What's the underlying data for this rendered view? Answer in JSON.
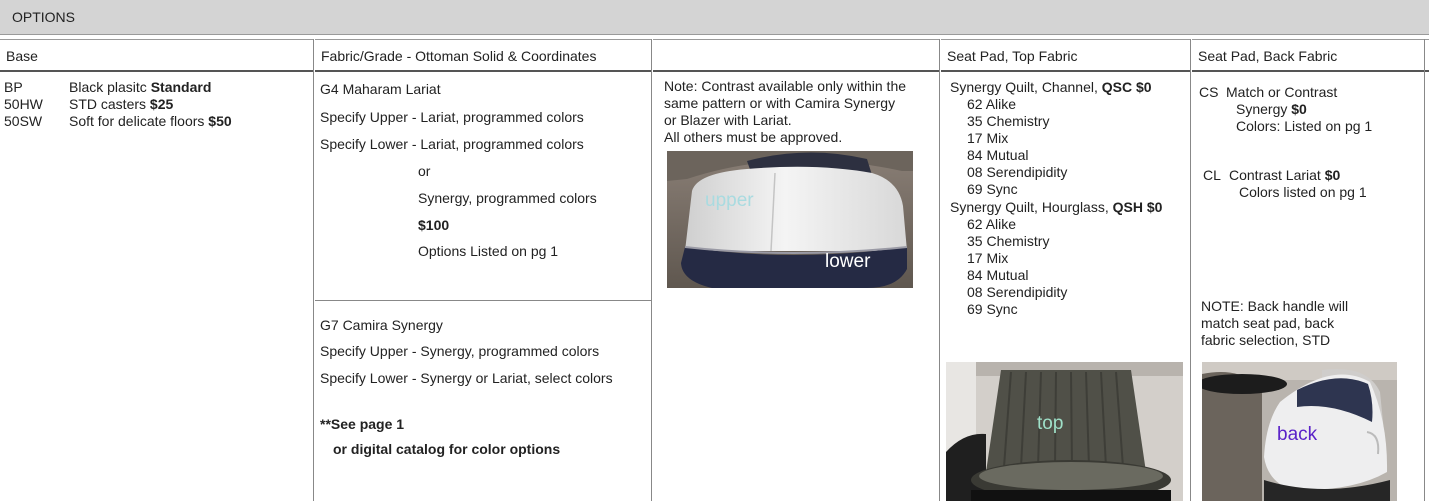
{
  "banner": "OPTIONS",
  "headers": {
    "base": "Base",
    "fabric": "Fabric/Grade - Ottoman Solid & Coordinates",
    "blank": "",
    "seat_top": "Seat Pad, Top Fabric",
    "seat_back": "Seat Pad, Back Fabric"
  },
  "base": {
    "rows": [
      {
        "code": "BP",
        "desc": "Black plasitc ",
        "bold": "Standard"
      },
      {
        "code": "50HW",
        "desc": "STD casters ",
        "bold": "$25"
      },
      {
        "code": "50SW",
        "desc": "Soft for delicate floors ",
        "bold": "$50"
      }
    ]
  },
  "fabric": {
    "g4_title": "G4 Maharam Lariat",
    "g4_upper": "Specify Upper - Lariat, programmed colors",
    "g4_lower": "Specify Lower - Lariat, programmed colors",
    "g4_or": "or",
    "g4_synergy": "Synergy, programmed colors",
    "g4_price": "$100",
    "g4_options": "Options Listed on pg 1",
    "g7_title": "G7 Camira Synergy",
    "g7_upper": "Specify Upper - Synergy, programmed colors",
    "g7_lower": "Specify Lower - Synergy or Lariat, select colors",
    "see1": "**See page 1",
    "see2": "or digital catalog for color options"
  },
  "note": {
    "line1": "Note: Contrast available only within the",
    "line2": "same pattern or with Camira Synergy",
    "line3": "or Blazer with Lariat.",
    "line4": "All others must be approved.",
    "img_upper": "upper",
    "img_lower": "lower"
  },
  "seat_top": {
    "qsc_title": "Synergy Quilt, Channel, ",
    "qsc_bold": "QSC $0",
    "qsc_colors": [
      "62 Alike",
      "35 Chemistry",
      "17 Mix",
      "84 Mutual",
      "08 Serendipidity",
      "69 Sync"
    ],
    "qsh_title": "Synergy Quilt, Hourglass, ",
    "qsh_bold": "QSH $0",
    "qsh_colors": [
      "62 Alike",
      "35 Chemistry",
      "17 Mix",
      "84 Mutual",
      "08 Serendipidity",
      "69 Sync"
    ],
    "img_label": "top"
  },
  "seat_back": {
    "cs_code": "CS",
    "cs_line1": "Match or Contrast",
    "cs_line2": "Synergy ",
    "cs_bold": "$0",
    "cs_line3": "Colors: Listed on pg 1",
    "cl_code": "CL",
    "cl_line1": "Contrast Lariat ",
    "cl_bold": "$0",
    "cl_line2": "Colors listed on pg 1",
    "note1": "NOTE: Back handle will",
    "note2": "match seat pad, back",
    "note3": "fabric selection, STD",
    "img_label": "back"
  },
  "colors": {
    "upper_label": "#a9dbe0",
    "lower_label": "#ffffff",
    "top_label": "#9fe0c8",
    "back_label": "#5a22c8"
  }
}
